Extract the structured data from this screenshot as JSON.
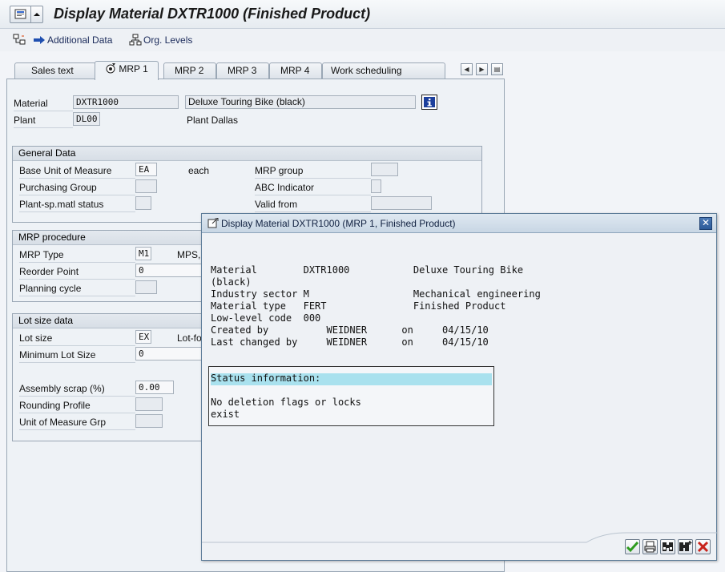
{
  "window": {
    "title": "Display Material DXTR1000 (Finished Product)"
  },
  "toolbar": {
    "additional_data": "Additional Data",
    "org_levels": "Org. Levels"
  },
  "tabs": [
    {
      "label": "Sales text",
      "active": false
    },
    {
      "label": "MRP 1",
      "active": true
    },
    {
      "label": "MRP 2",
      "active": false
    },
    {
      "label": "MRP 3",
      "active": false
    },
    {
      "label": "MRP 4",
      "active": false
    },
    {
      "label": "Work scheduling",
      "active": false
    }
  ],
  "header": {
    "material_label": "Material",
    "material_value": "DXTR1000",
    "material_desc": "Deluxe Touring Bike (black)",
    "plant_label": "Plant",
    "plant_value": "DL00",
    "plant_desc": "Plant Dallas"
  },
  "general_data": {
    "title": "General Data",
    "base_uom_label": "Base Unit of Measure",
    "base_uom_value": "EA",
    "base_uom_text": "each",
    "mrp_group_label": "MRP group",
    "purch_group_label": "Purchasing Group",
    "abc_label": "ABC Indicator",
    "status_label": "Plant-sp.matl status",
    "valid_from_label": "Valid from"
  },
  "mrp_procedure": {
    "title": "MRP procedure",
    "mrp_type_label": "MRP Type",
    "mrp_type_value": "M1",
    "mrp_type_text": "MPS,",
    "reorder_label": "Reorder Point",
    "reorder_value": "0",
    "planning_cycle_label": "Planning cycle"
  },
  "lot_size": {
    "title": "Lot size data",
    "lot_size_label": "Lot size",
    "lot_size_value": "EX",
    "lot_size_text": "Lot-fo",
    "min_lot_label": "Minimum Lot Size",
    "min_lot_value": "0",
    "scrap_label": "Assembly scrap (%)",
    "scrap_value": "0.00",
    "rounding_label": "Rounding Profile",
    "uom_grp_label": "Unit of Measure Grp"
  },
  "dialog": {
    "title": "Display Material DXTR1000 (MRP 1, Finished Product)",
    "lines": [
      "Material        DXTR1000           Deluxe Touring Bike",
      "(black)",
      "Industry sector M                  Mechanical engineering",
      "Material type   FERT               Finished Product",
      "Low-level code  000",
      "Created by          WEIDNER      on     04/15/10",
      "Last changed by     WEIDNER      on     04/15/10"
    ],
    "status_header": "Status information:",
    "status_lines": [
      "No deletion flags or locks",
      "exist"
    ]
  },
  "colors": {
    "title_text": "#1a1a1a",
    "status_highlight": "#a9e1ee",
    "info_button": "#1c3f9c",
    "ok_check": "#2e9b1e",
    "cancel_x": "#c8231b"
  }
}
